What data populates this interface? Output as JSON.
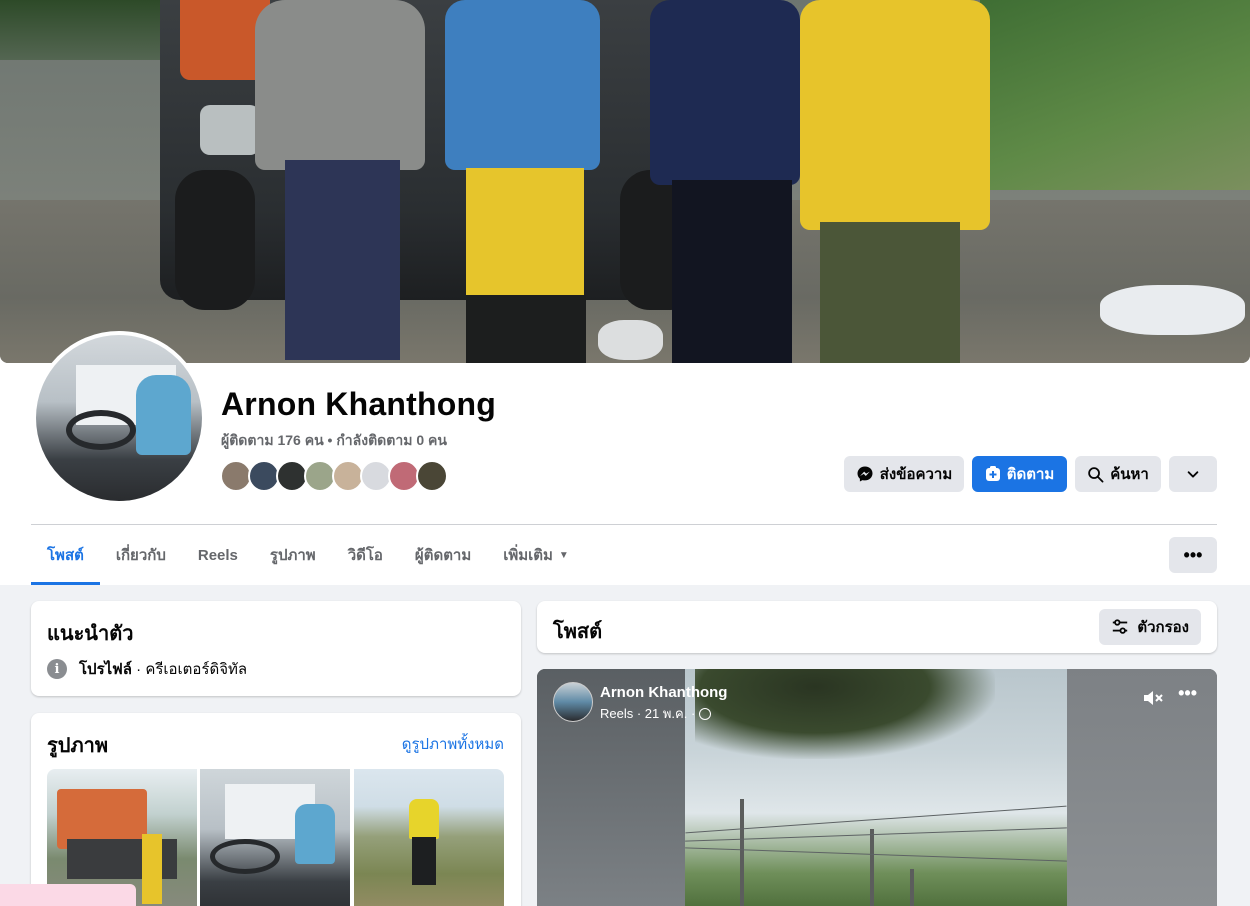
{
  "profile": {
    "name": "Arnon Khanthong",
    "stats": "ผู้ติดตาม 176 คน • กำลังติดตาม 0 คน"
  },
  "actions": {
    "message": "ส่งข้อความ",
    "follow": "ติดตาม",
    "search": "ค้นหา"
  },
  "tabs": [
    {
      "label": "โพสต์"
    },
    {
      "label": "เกี่ยวกับ"
    },
    {
      "label": "Reels"
    },
    {
      "label": "รูปภาพ"
    },
    {
      "label": "วิดีโอ"
    },
    {
      "label": "ผู้ติดตาม"
    },
    {
      "label": "เพิ่มเติม"
    }
  ],
  "intro": {
    "title": "แนะนำตัว",
    "profile_label": "โปรไฟล์",
    "profile_value": " · ครีเอเตอร์ดิจิทัล"
  },
  "photos": {
    "title": "รูปภาพ",
    "see_all": "ดูรูปภาพทั้งหมด"
  },
  "posts": {
    "title": "โพสต์",
    "filter": "ตัวกรอง"
  },
  "reel": {
    "author": "Arnon Khanthong",
    "meta": "Reels · 21 พ.ค. ·"
  },
  "colors": {
    "accent": "#1b74e4",
    "background": "#f0f2f5",
    "button_gray": "#e4e6eb"
  },
  "icons": [
    "messenger-icon",
    "follow-icon",
    "search-icon",
    "chevron-down-icon",
    "more-icon",
    "info-icon",
    "filter-icon",
    "mute-icon",
    "globe-icon"
  ]
}
